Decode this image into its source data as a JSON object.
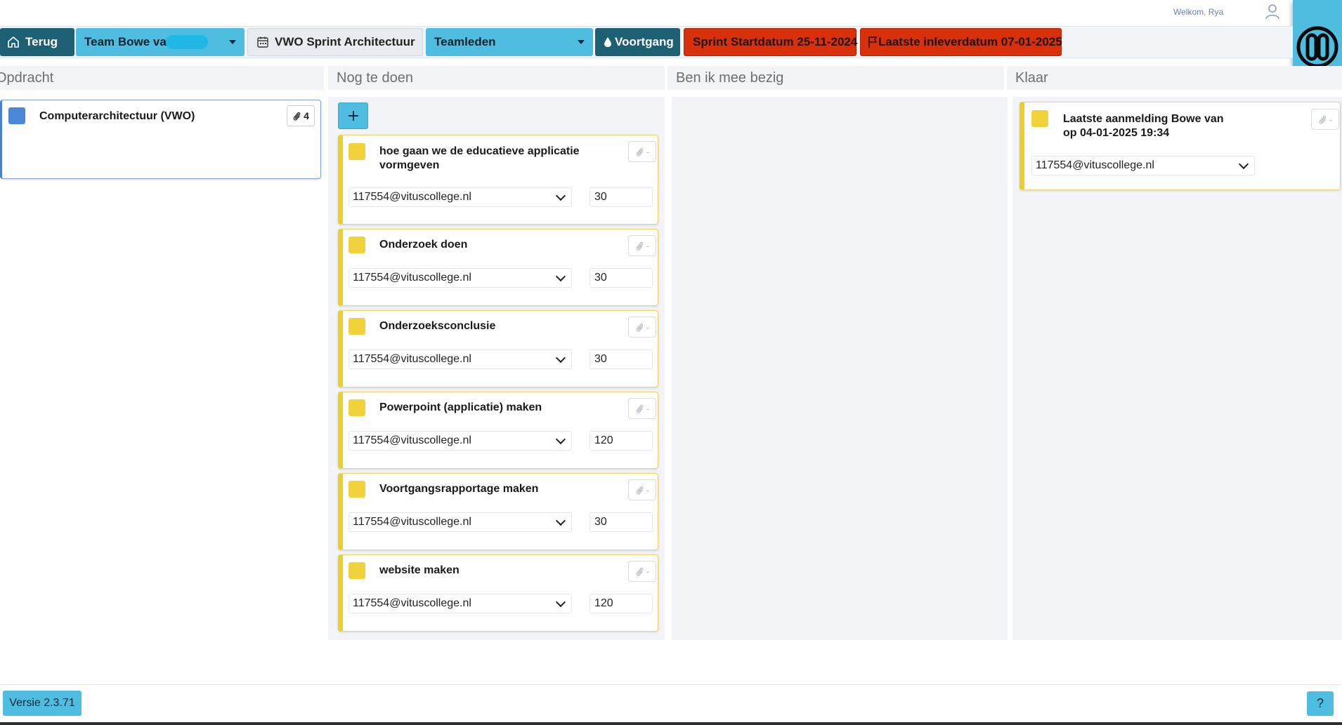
{
  "header": {
    "welcome": "Welkom, Rya",
    "back_label": "Terug",
    "team_label": "Team Bowe var",
    "sprint_label": "VWO Sprint Architectuur",
    "members_label": "Teamleden",
    "progress_label": "Voortgang",
    "start_label": "Sprint Startdatum 25-11-2024",
    "deadline_label": "Laatste inleverdatum 07-01-2025"
  },
  "columns": {
    "assignment": "Opdracht",
    "todo": "Nog te doen",
    "doing": "Ben ik mee bezig",
    "done": "Klaar"
  },
  "assignment_card": {
    "title": "Computerarchitectuur (VWO)",
    "attachments": "4",
    "color": "#4a87d6"
  },
  "todo_add_label": "+",
  "todo_cards": [
    {
      "title_lines": [
        "hoe gaan we de educatieve applicatie",
        "vormgeven"
      ],
      "attachments": "-",
      "assignee": "117554@vituscollege.nl",
      "minutes": "30"
    },
    {
      "title_lines": [
        "Onderzoek doen"
      ],
      "attachments": "-",
      "assignee": "117554@vituscollege.nl",
      "minutes": "30"
    },
    {
      "title_lines": [
        "Onderzoeksconclusie"
      ],
      "attachments": "-",
      "assignee": "117554@vituscollege.nl",
      "minutes": "30"
    },
    {
      "title_lines": [
        "Powerpoint (applicatie) maken"
      ],
      "attachments": "-",
      "assignee": "117554@vituscollege.nl",
      "minutes": "120"
    },
    {
      "title_lines": [
        "Voortgangsrapportage maken"
      ],
      "attachments": "-",
      "assignee": "117554@vituscollege.nl",
      "minutes": "30"
    },
    {
      "title_lines": [
        "website maken"
      ],
      "attachments": "-",
      "assignee": "117554@vituscollege.nl",
      "minutes": "120"
    }
  ],
  "done_cards": [
    {
      "title_lines": [
        "Laatste aanmelding Bowe van",
        "op 04-01-2025 19:34"
      ],
      "attachments": "-",
      "assignee": "117554@vituscollege.nl"
    }
  ],
  "footer": {
    "version": "Versie 2.3.71",
    "help": "?"
  },
  "colors": {
    "accent": "#4fbde0",
    "dark_teal": "#1d5f73",
    "alert_red": "#d8300a",
    "task_yellow": "#f1d23a"
  }
}
